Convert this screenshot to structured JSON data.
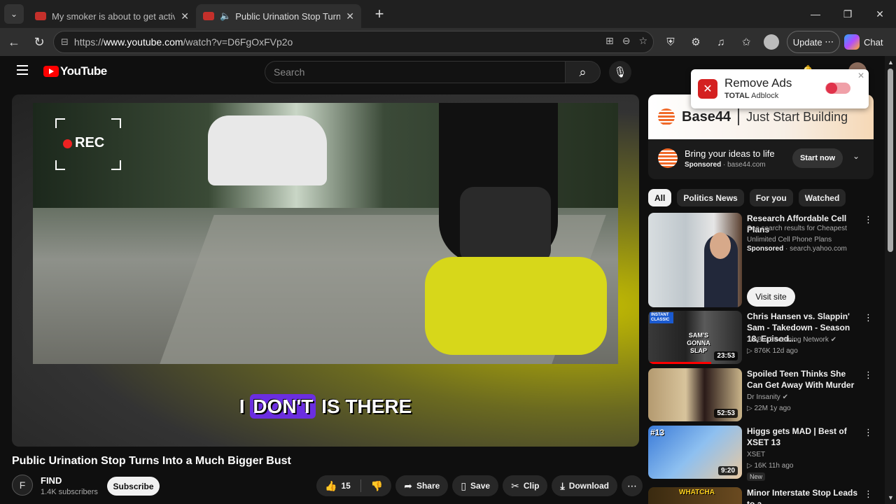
{
  "browser": {
    "tabs": [
      {
        "title": "My smoker is about to get active."
      },
      {
        "title": "Public Urination Stop Turns In"
      }
    ],
    "url_prefix": "https://",
    "url_domain": "www.youtube.com",
    "url_path": "/watch?v=D6FgOxFVp2o",
    "update_label": "Update",
    "chat_label": "Chat"
  },
  "youtube": {
    "logo_text": "YouTube",
    "search_placeholder": "Search"
  },
  "video": {
    "rec_label": "REC",
    "caption_pre": "I",
    "caption_highlight": "DON'T",
    "caption_post": "IS THERE",
    "title": "Public Urination Stop Turns Into a Much Bigger Bust",
    "channel_initial": "F",
    "channel": "FIND",
    "subscribers": "1.4K subscribers",
    "subscribe_label": "Subscribe",
    "likes": "15",
    "share_label": "Share",
    "save_label": "Save",
    "clip_label": "Clip",
    "download_label": "Download"
  },
  "removeads": {
    "title": "Remove Ads",
    "brand_bold": "TOTAL",
    "brand_rest": "Adblock"
  },
  "ad_top": {
    "brand": "Base44",
    "tagline": "Just Start Building",
    "headline": "Bring your ideas to life",
    "sponsored": "Sponsored",
    "domain": "base44.com",
    "cta": "Start now"
  },
  "chips": [
    "All",
    "Politics News",
    "For you",
    "Watched"
  ],
  "recommendations": [
    {
      "title": "Research Affordable Cell Plans",
      "desc": "See search results for Cheapest Unlimited Cell Phone Plans",
      "sponsored": "Sponsored",
      "source": "search.yahoo.com",
      "cta": "Visit site"
    },
    {
      "title": "Chris Hansen vs. Slappin' Sam - Takedown - Season 18, Episod...",
      "channel": "TruBlu Streaming Network",
      "stats": "876K  12d ago",
      "duration": "23:53",
      "thumb_text": "SAM'S GONNA SLAP",
      "badge": "INSTANT CLASSIC"
    },
    {
      "title": "Spoiled Teen Thinks She Can Get Away With Murder",
      "channel": "Dr Insanity",
      "stats": "22M  1y ago",
      "duration": "52:53"
    },
    {
      "title": "Higgs gets MAD | Best of XSET 13",
      "channel": "XSET",
      "stats": "16K  11h ago",
      "duration": "9:20",
      "badge": "New",
      "thumb_text": "#13"
    },
    {
      "title": "Minor Interstate Stop Leads to a",
      "thumb_text": "WHATCHA"
    }
  ]
}
